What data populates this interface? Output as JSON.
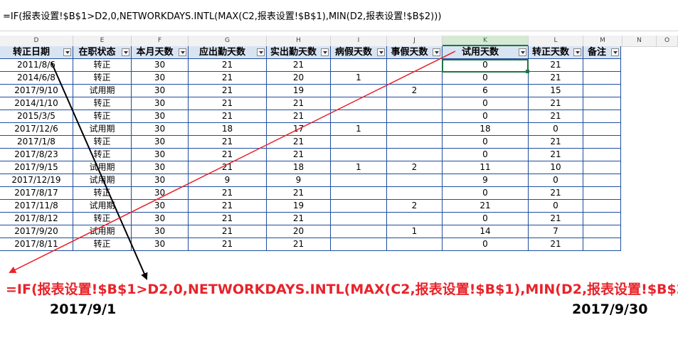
{
  "formula_bar": {
    "text": "=IF(报表设置!$B$1>D2,0,NETWORKDAYS.INTL(MAX(C2,报表设置!$B$1),MIN(D2,报表设置!$B$2)))"
  },
  "columns": [
    "D",
    "E",
    "F",
    "G",
    "H",
    "I",
    "J",
    "K",
    "L",
    "M",
    "N",
    "O"
  ],
  "selected_column": "K",
  "table": {
    "headers": [
      "转正日期",
      "在职状态",
      "本月天数",
      "应出勤天数",
      "实出勤天数",
      "病假天数",
      "事假天数",
      "试用天数",
      "转正天数",
      "备注"
    ],
    "rows": [
      [
        "2011/8/6",
        "转正",
        "30",
        "21",
        "21",
        "",
        "",
        "0",
        "21",
        ""
      ],
      [
        "2014/6/8",
        "转正",
        "30",
        "21",
        "20",
        "1",
        "",
        "0",
        "21",
        ""
      ],
      [
        "2017/9/10",
        "试用期",
        "30",
        "21",
        "19",
        "",
        "2",
        "6",
        "15",
        ""
      ],
      [
        "2014/1/10",
        "转正",
        "30",
        "21",
        "21",
        "",
        "",
        "0",
        "21",
        ""
      ],
      [
        "2015/3/5",
        "转正",
        "30",
        "21",
        "21",
        "",
        "",
        "0",
        "21",
        ""
      ],
      [
        "2017/12/6",
        "试用期",
        "30",
        "18",
        "17",
        "1",
        "",
        "18",
        "0",
        ""
      ],
      [
        "2017/1/8",
        "转正",
        "30",
        "21",
        "21",
        "",
        "",
        "0",
        "21",
        ""
      ],
      [
        "2017/8/23",
        "转正",
        "30",
        "21",
        "21",
        "",
        "",
        "0",
        "21",
        ""
      ],
      [
        "2017/9/15",
        "试用期",
        "30",
        "21",
        "18",
        "1",
        "2",
        "11",
        "10",
        ""
      ],
      [
        "2017/12/19",
        "试用期",
        "30",
        "9",
        "9",
        "",
        "",
        "9",
        "0",
        ""
      ],
      [
        "2017/8/17",
        "转正",
        "30",
        "21",
        "21",
        "",
        "",
        "0",
        "21",
        ""
      ],
      [
        "2017/11/8",
        "试用期",
        "30",
        "21",
        "19",
        "",
        "2",
        "21",
        "0",
        ""
      ],
      [
        "2017/8/12",
        "转正",
        "30",
        "21",
        "21",
        "",
        "",
        "0",
        "21",
        ""
      ],
      [
        "2017/9/20",
        "试用期",
        "30",
        "21",
        "20",
        "",
        "1",
        "14",
        "7",
        ""
      ],
      [
        "2017/8/11",
        "转正",
        "30",
        "21",
        "21",
        "",
        "",
        "0",
        "21",
        ""
      ]
    ]
  },
  "annotation": {
    "formula": "=IF(报表设置!$B$1>D2,0,NETWORKDAYS.INTL(MAX(C2,报表设置!$B$1),MIN(D2,报表设置!$B$2)))",
    "start_date": "2017/9/1",
    "end_date": "2017/9/30",
    "formula_color": "#e8232a",
    "header_fill": "#d9e4f3",
    "border_color": "#1f4e9e",
    "selection_color": "#217346"
  }
}
